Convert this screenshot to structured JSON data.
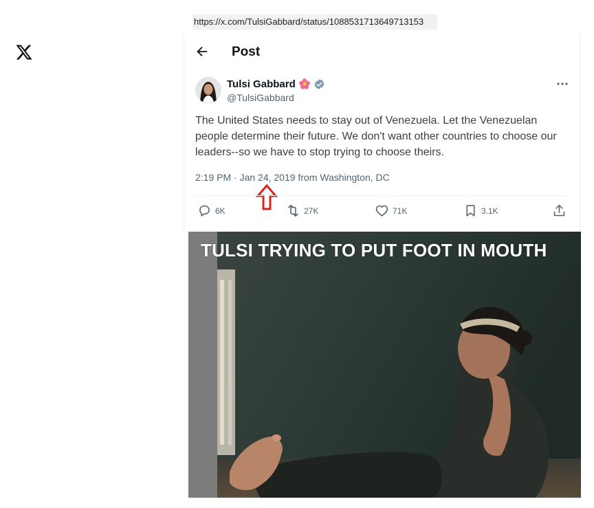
{
  "browser": {
    "url": "https://x.com/TulsiGabbard/status/1088531713649713153"
  },
  "header": {
    "title": "Post"
  },
  "author": {
    "name": "Tulsi Gabbard",
    "handle": "@TulsiGabbard"
  },
  "tweet": {
    "text": "The United States needs to stay out of Venezuela. Let the Venezuelan people determine their future. We don't want other countries to choose our leaders--so we have to stop trying to choose theirs.",
    "timestamp": "2:19 PM · Jan 24, 2019 from Washington, DC"
  },
  "actions": {
    "replies": "6K",
    "reposts": "27K",
    "likes": "71K",
    "bookmarks": "3.1K"
  },
  "meme": {
    "caption": "TULSI TRYING TO PUT FOOT IN MOUTH"
  },
  "colors": {
    "annotation_arrow": "#e02020",
    "verified": "#829aab",
    "secondary_text": "#536471"
  },
  "icons": [
    "x-logo-icon",
    "back-arrow-icon",
    "flower-emoji-icon",
    "verified-badge-icon",
    "more-icon",
    "reply-icon",
    "repost-icon",
    "like-icon",
    "bookmark-icon",
    "share-icon",
    "red-up-arrow-icon"
  ]
}
